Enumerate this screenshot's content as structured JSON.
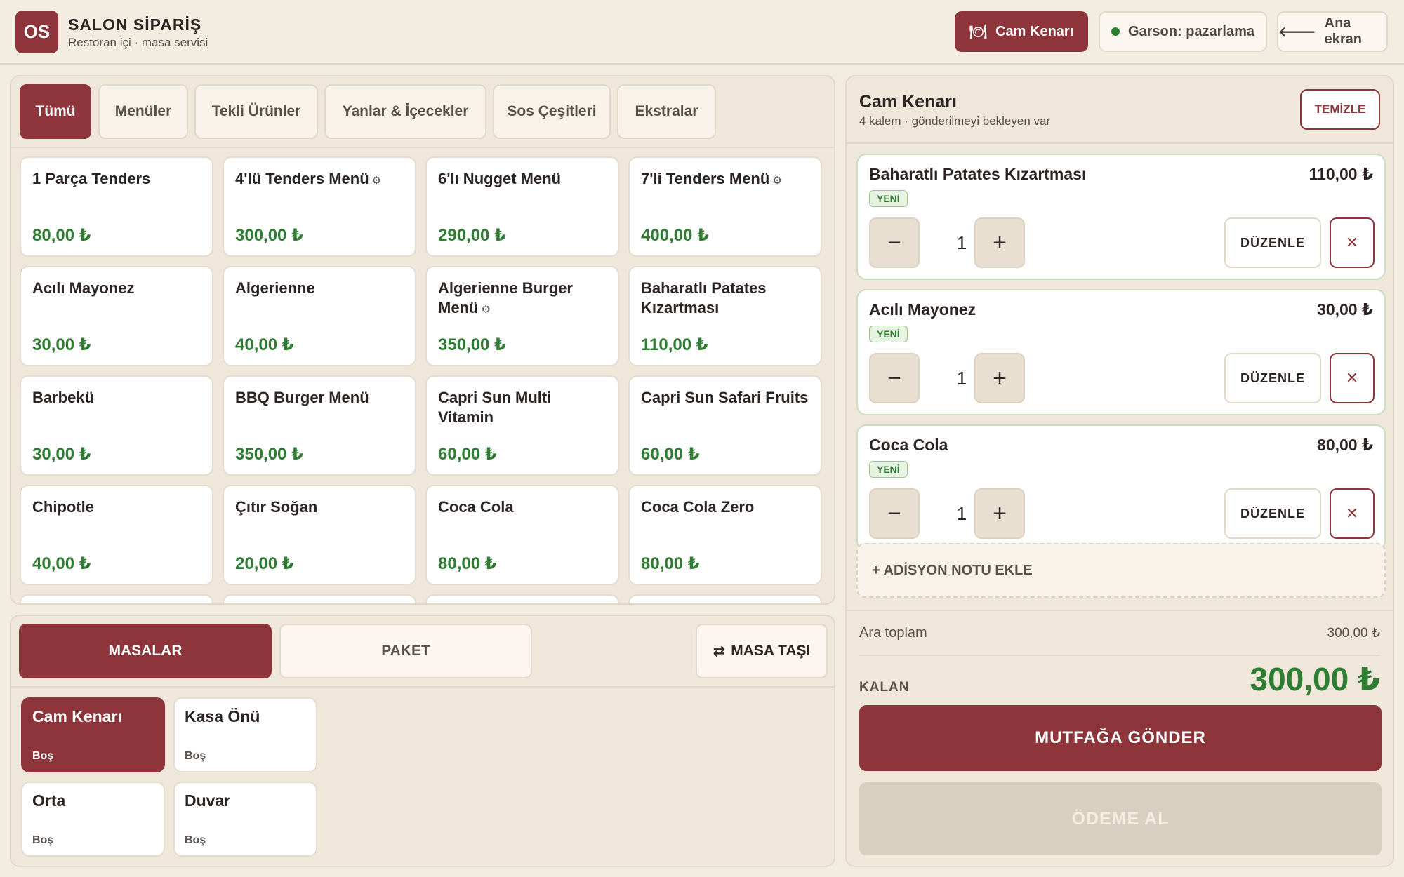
{
  "header": {
    "logo": "OS",
    "title": "SALON SİPARİŞ",
    "subtitle": "Restoran içi · masa servisi",
    "table_button": "Cam Kenarı",
    "waiter": "Garson: pazarlama",
    "home": "Ana ekran"
  },
  "menu": {
    "tabs": [
      {
        "label": "Tümü",
        "active": true
      },
      {
        "label": "Menüler"
      },
      {
        "label": "Tekli Ürünler"
      },
      {
        "label": "Yanlar & İçecekler"
      },
      {
        "label": "Sos Çeşitleri"
      },
      {
        "label": "Ekstralar"
      }
    ],
    "products": [
      {
        "name": "1 Parça Tenders",
        "price": "80,00 ₺"
      },
      {
        "name": "4'lü Tenders Menü",
        "price": "300,00 ₺",
        "gear": "⚙"
      },
      {
        "name": "6'lı Nugget Menü",
        "price": "290,00 ₺"
      },
      {
        "name": "7'li Tenders Menü",
        "price": "400,00 ₺",
        "gear": "⚙"
      },
      {
        "name": "Acılı Mayonez",
        "price": "30,00 ₺"
      },
      {
        "name": "Algerienne",
        "price": "40,00 ₺"
      },
      {
        "name": "Algerienne Burger Menü",
        "price": "350,00 ₺",
        "gear": "⚙"
      },
      {
        "name": "Baharatlı Patates Kızartması",
        "price": "110,00 ₺"
      },
      {
        "name": "Barbekü",
        "price": "30,00 ₺"
      },
      {
        "name": "BBQ Burger Menü",
        "price": "350,00 ₺"
      },
      {
        "name": "Capri Sun Multi Vitamin",
        "price": "60,00 ₺"
      },
      {
        "name": "Capri Sun Safari Fruits",
        "price": "60,00 ₺"
      },
      {
        "name": "Chipotle",
        "price": "40,00 ₺"
      },
      {
        "name": "Çıtır Soğan",
        "price": "20,00 ₺"
      },
      {
        "name": "Coca Cola",
        "price": "80,00 ₺"
      },
      {
        "name": "Coca Cola Zero",
        "price": "80,00 ₺"
      }
    ]
  },
  "tables": {
    "tabs": {
      "masalar": "MASALAR",
      "paket": "PAKET",
      "move": "MASA TAŞI"
    },
    "items": [
      {
        "name": "Cam Kenarı",
        "status": "Boş",
        "active": true
      },
      {
        "name": "Kasa Önü",
        "status": "Boş"
      },
      {
        "name": "Orta",
        "status": "Boş"
      },
      {
        "name": "Duvar",
        "status": "Boş"
      }
    ]
  },
  "order": {
    "title": "Cam Kenarı",
    "subtitle": "4 kalem · gönderilmeyi bekleyen var",
    "clear": "TEMİZLE",
    "items": [
      {
        "name": "Baharatlı Patates Kızartması",
        "price": "110,00 ₺",
        "badge": "YENİ",
        "qty": "1",
        "minus": "−",
        "plus": "+",
        "edit": "DÜZENLE",
        "remove": "✕"
      },
      {
        "name": "Acılı Mayonez",
        "price": "30,00 ₺",
        "badge": "YENİ",
        "qty": "1",
        "minus": "−",
        "plus": "+",
        "edit": "DÜZENLE",
        "remove": "✕"
      },
      {
        "name": "Coca Cola",
        "price": "80,00 ₺",
        "badge": "YENİ",
        "qty": "1",
        "minus": "−",
        "plus": "+",
        "edit": "DÜZENLE",
        "remove": "✕"
      }
    ],
    "note": "+ ADİSYON NOTU EKLE",
    "subtotal_label": "Ara toplam",
    "subtotal": "300,00 ₺",
    "remaining_label": "KALAN",
    "remaining": "300,00 ₺",
    "send": "MUTFAĞA GÖNDER",
    "pay": "ÖDEME AL"
  },
  "colors": {
    "accent": "#8d353a",
    "price": "#2e7d32",
    "background": "#f2ebdf"
  }
}
